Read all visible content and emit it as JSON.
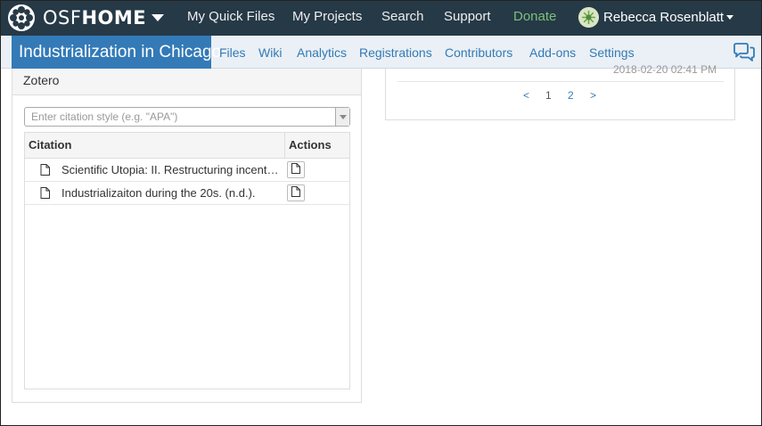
{
  "topnav": {
    "brand_light": "OSF",
    "brand_bold": "HOME",
    "links": [
      "My Quick Files",
      "My Projects",
      "Search",
      "Support"
    ],
    "donate": "Donate",
    "user_name": "Rebecca Rosenblatt"
  },
  "project": {
    "title": "Industrialization in Chicago",
    "nav": [
      "Files",
      "Wiki",
      "Analytics",
      "Registrations",
      "Contributors",
      "Add-ons",
      "Settings"
    ]
  },
  "zotero": {
    "title": "Zotero",
    "style_placeholder": "Enter citation style (e.g. \"APA\")",
    "columns": {
      "citation": "Citation",
      "actions": "Actions"
    },
    "citations": [
      "Scientific Utopia: II. Restructuring incentives and practices to promote truth over publishability.",
      "Industrializaiton during the 20s. (n.d.)."
    ]
  },
  "activity": {
    "timestamp": "2018-02-20 02:41 PM",
    "pager": {
      "prev": "<",
      "pages": [
        "1",
        "2"
      ],
      "next": ">"
    }
  },
  "colors": {
    "navbar": "#263947",
    "accent": "#337ab7",
    "donate": "#7cc07b"
  }
}
